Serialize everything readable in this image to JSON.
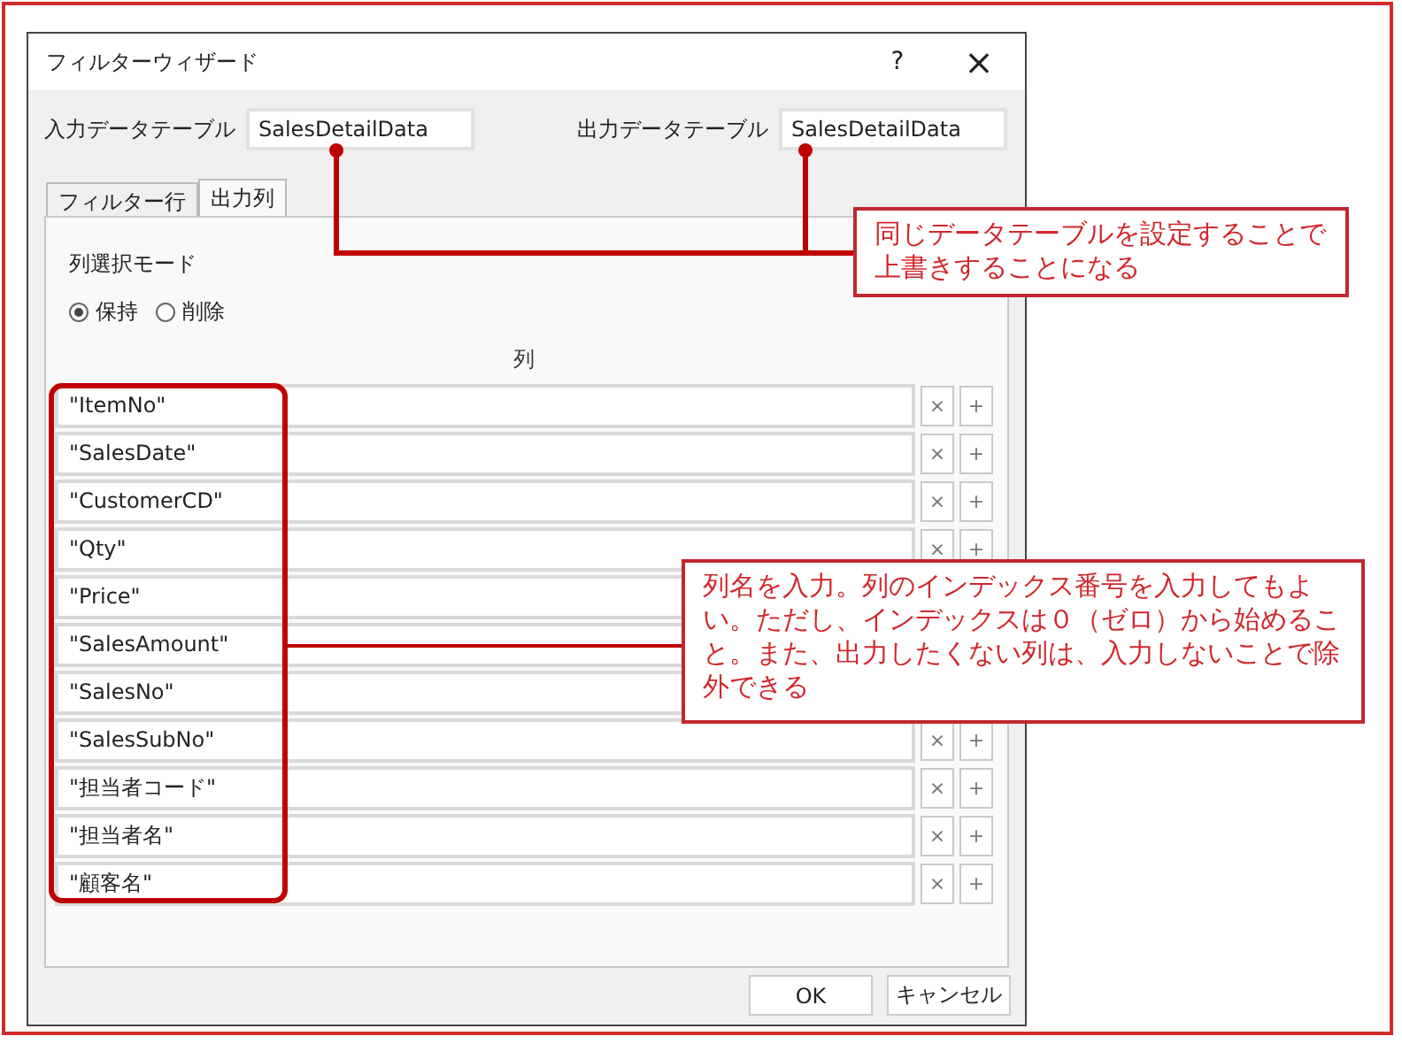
{
  "window": {
    "title": "フィルターウィザード",
    "help": "?",
    "close": "×"
  },
  "input_table": {
    "label": "入力データテーブル",
    "value": "SalesDetailData"
  },
  "output_table": {
    "label": "出力データテーブル",
    "value": "SalesDetailData"
  },
  "tabs": [
    {
      "label": "フィルター行",
      "selected": false
    },
    {
      "label": "出力列",
      "selected": true
    }
  ],
  "mode": {
    "label": "列選択モード",
    "options": [
      {
        "label": "保持",
        "selected": true
      },
      {
        "label": "削除",
        "selected": false
      }
    ]
  },
  "column_header": "列",
  "rows": [
    {
      "value": "\"ItemNo\"",
      "buttons": [
        "×",
        "+"
      ]
    },
    {
      "value": "\"SalesDate\"",
      "buttons": [
        "×",
        "+"
      ]
    },
    {
      "value": "\"CustomerCD\"",
      "buttons": [
        "×",
        "+"
      ]
    },
    {
      "value": "\"Qty\"",
      "buttons": [
        "×",
        "+"
      ]
    },
    {
      "value": "\"Price\""
    },
    {
      "value": "\"SalesAmount\""
    },
    {
      "value": "\"SalesNo\""
    },
    {
      "value": "\"SalesSubNo\"",
      "buttons": [
        "×",
        "+"
      ]
    },
    {
      "value": "\"担当者コード\"",
      "buttons": [
        "×",
        "+"
      ]
    },
    {
      "value": "\"担当者名\"",
      "buttons": [
        "×",
        "+"
      ]
    },
    {
      "value": "\"顧客名\"",
      "buttons": [
        "×",
        "+"
      ]
    }
  ],
  "buttons": [
    "OK",
    "キャンセル"
  ],
  "callouts": [
    {
      "text": "同じデータテーブルを設定することで上書きすることになる"
    },
    {
      "text": "列名を入力。列のインデックス番号を入力してもよい。ただし、インデックスは０（ゼロ）から始めること。また、出力したくない列は、入力しないことで除外できる"
    }
  ]
}
